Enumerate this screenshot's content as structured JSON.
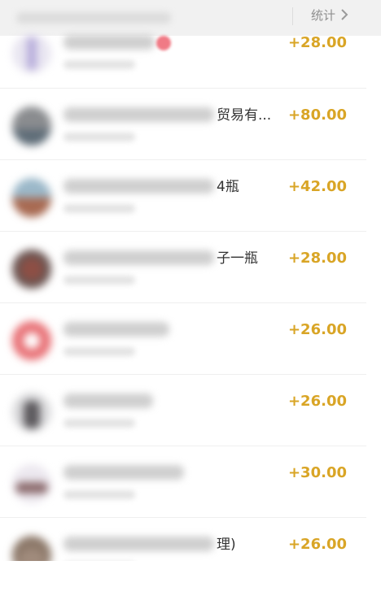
{
  "header": {
    "stats_label": "统计"
  },
  "transactions": [
    {
      "title_tail": "",
      "amount": "+28.00",
      "has_badge": true
    },
    {
      "title_tail": "贸易有...",
      "amount": "+80.00"
    },
    {
      "title_tail": "4瓶",
      "amount": "+42.00"
    },
    {
      "title_tail": "子一瓶",
      "amount": "+28.00"
    },
    {
      "title_tail": "",
      "amount": "+26.00"
    },
    {
      "title_tail": "",
      "amount": "+26.00"
    },
    {
      "title_tail": "",
      "amount": "+30.00"
    },
    {
      "title_tail": "理)",
      "amount": "+26.00"
    }
  ],
  "colors": {
    "amount": "#d9a526",
    "topbar_bg": "#f1f1f1",
    "badge": "#f07a85"
  },
  "icons": {
    "stats_arrow": "chevron-right-icon"
  }
}
